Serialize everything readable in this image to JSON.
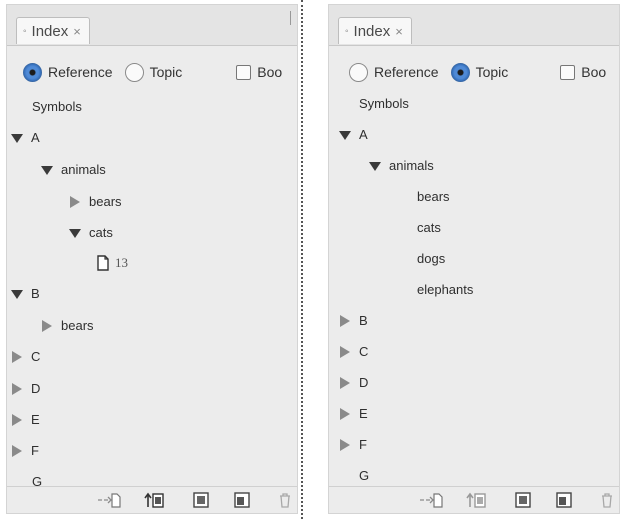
{
  "panels": [
    {
      "tab": {
        "dot": "◦",
        "label": "Index",
        "close": "×"
      },
      "radios": [
        {
          "label": "Reference",
          "selected": true
        },
        {
          "label": "Topic",
          "selected": false
        }
      ],
      "checkbox": {
        "label": "Boo"
      },
      "entries": [
        {
          "text": "Symbols",
          "toggle": "none"
        },
        {
          "text": "A",
          "toggle": "open"
        },
        {
          "text": "animals",
          "toggle": "open"
        },
        {
          "text": "bears",
          "toggle": "closed"
        },
        {
          "text": "cats",
          "toggle": "open"
        },
        {
          "text": "13",
          "toggle": "page"
        },
        {
          "text": "B",
          "toggle": "open"
        },
        {
          "text": "bears",
          "toggle": "closed"
        },
        {
          "text": "C",
          "toggle": "closed"
        },
        {
          "text": "D",
          "toggle": "closed"
        },
        {
          "text": "E",
          "toggle": "closed"
        },
        {
          "text": "F",
          "toggle": "closed"
        },
        {
          "text": "G",
          "toggle": "none"
        }
      ],
      "toolbar": [
        "go-to-entry-icon",
        "update-preview-icon",
        "new-entry-icon",
        "generate-index-icon",
        "delete-icon"
      ]
    },
    {
      "tab": {
        "dot": "◦",
        "label": "Index",
        "close": "×"
      },
      "radios": [
        {
          "label": "Reference",
          "selected": false
        },
        {
          "label": "Topic",
          "selected": true
        }
      ],
      "checkbox": {
        "label": "Boo"
      },
      "entries": [
        {
          "text": "Symbols",
          "toggle": "none"
        },
        {
          "text": "A",
          "toggle": "open"
        },
        {
          "text": "animals",
          "toggle": "open"
        },
        {
          "text": "bears",
          "toggle": "none"
        },
        {
          "text": "cats",
          "toggle": "none"
        },
        {
          "text": "dogs",
          "toggle": "none"
        },
        {
          "text": "elephants",
          "toggle": "none"
        },
        {
          "text": "B",
          "toggle": "closed"
        },
        {
          "text": "C",
          "toggle": "closed"
        },
        {
          "text": "D",
          "toggle": "closed"
        },
        {
          "text": "E",
          "toggle": "closed"
        },
        {
          "text": "F",
          "toggle": "closed"
        },
        {
          "text": "G",
          "toggle": "none"
        }
      ],
      "toolbar": [
        "go-to-entry-icon",
        "update-preview-icon",
        "new-entry-icon",
        "generate-index-icon",
        "delete-icon"
      ]
    }
  ]
}
